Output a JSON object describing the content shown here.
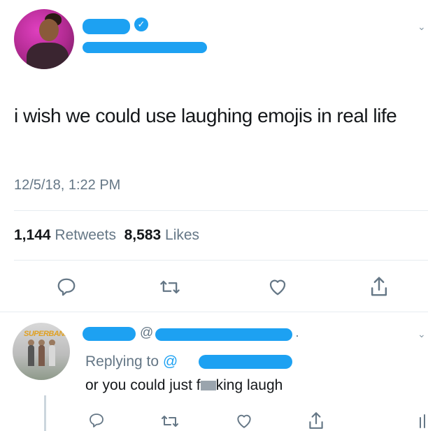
{
  "tweet": {
    "text": "i wish we could use laughing emojis in real life",
    "timestamp": "12/5/18, 1:22 PM",
    "retweets_count": "1,144",
    "retweets_label": "Retweets",
    "likes_count": "8,583",
    "likes_label": "Likes",
    "verified": true
  },
  "reply": {
    "handle_prefix": "@",
    "separator": "·",
    "replying_to_label": "Replying to",
    "replying_to_at": "@",
    "text_before": "or you could just f",
    "text_after": "king laugh",
    "avatar_text": "SUPERBAND"
  },
  "icons": {
    "reply": "reply-icon",
    "retweet": "retweet-icon",
    "like": "heart-icon",
    "share": "share-icon",
    "chevron": "chevron-down-icon",
    "verified": "verified-badge-icon"
  },
  "colors": {
    "redaction": "#1da1f2",
    "text": "#14171a",
    "secondary": "#657786",
    "divider": "#e6ecf0",
    "link": "#1da1f2"
  }
}
